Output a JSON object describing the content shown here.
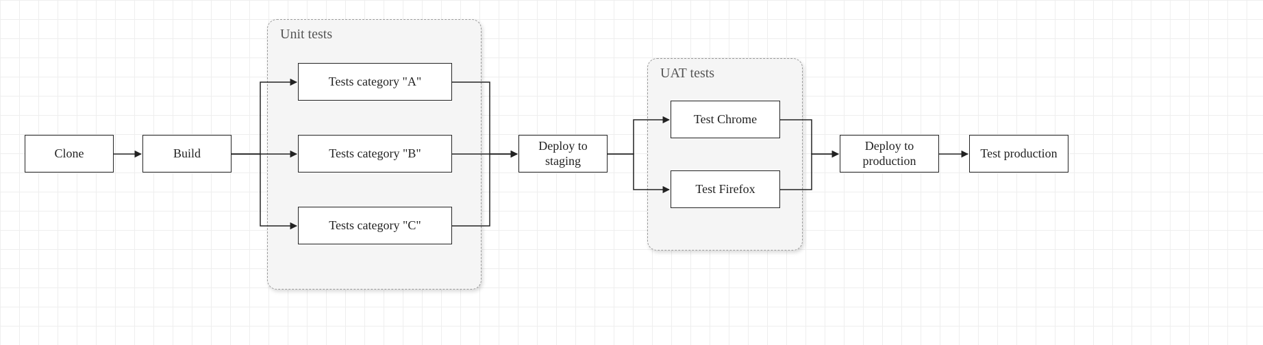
{
  "nodes": {
    "clone": "Clone",
    "build": "Build",
    "tests_a": "Tests category \"A\"",
    "tests_b": "Tests category \"B\"",
    "tests_c": "Tests category \"C\"",
    "deploy_staging": "Deploy to staging",
    "test_chrome": "Test Chrome",
    "test_firefox": "Test Firefox",
    "deploy_production": "Deploy to production",
    "test_production": "Test production"
  },
  "groups": {
    "unit_tests": "Unit tests",
    "uat_tests": "UAT tests"
  },
  "chart_data": {
    "type": "flowchart",
    "direction": "LR",
    "nodes": [
      {
        "id": "clone",
        "label": "Clone"
      },
      {
        "id": "build",
        "label": "Build"
      },
      {
        "id": "tests_a",
        "label": "Tests category \"A\"",
        "group": "unit_tests"
      },
      {
        "id": "tests_b",
        "label": "Tests category \"B\"",
        "group": "unit_tests"
      },
      {
        "id": "tests_c",
        "label": "Tests category \"C\"",
        "group": "unit_tests"
      },
      {
        "id": "deploy_staging",
        "label": "Deploy to staging"
      },
      {
        "id": "test_chrome",
        "label": "Test Chrome",
        "group": "uat_tests"
      },
      {
        "id": "test_firefox",
        "label": "Test Firefox",
        "group": "uat_tests"
      },
      {
        "id": "deploy_production",
        "label": "Deploy to production"
      },
      {
        "id": "test_production",
        "label": "Test production"
      }
    ],
    "groups": [
      {
        "id": "unit_tests",
        "label": "Unit tests"
      },
      {
        "id": "uat_tests",
        "label": "UAT tests"
      }
    ],
    "edges": [
      {
        "from": "clone",
        "to": "build"
      },
      {
        "from": "build",
        "to": "tests_a"
      },
      {
        "from": "build",
        "to": "tests_b"
      },
      {
        "from": "build",
        "to": "tests_c"
      },
      {
        "from": "tests_a",
        "to": "deploy_staging"
      },
      {
        "from": "tests_b",
        "to": "deploy_staging"
      },
      {
        "from": "tests_c",
        "to": "deploy_staging"
      },
      {
        "from": "deploy_staging",
        "to": "test_chrome"
      },
      {
        "from": "deploy_staging",
        "to": "test_firefox"
      },
      {
        "from": "test_chrome",
        "to": "deploy_production"
      },
      {
        "from": "test_firefox",
        "to": "deploy_production"
      },
      {
        "from": "deploy_production",
        "to": "test_production"
      }
    ]
  }
}
